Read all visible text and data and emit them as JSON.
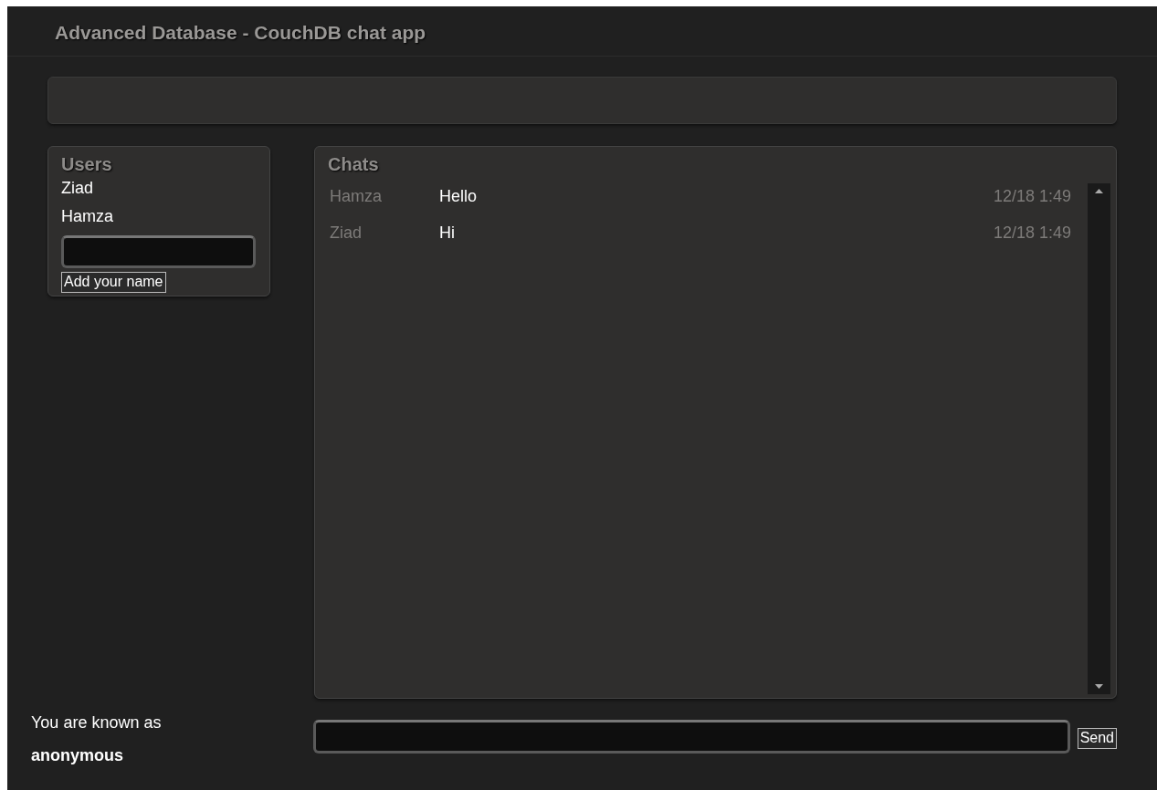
{
  "header": {
    "title": "Advanced Database - CouchDB chat app"
  },
  "users": {
    "title": "Users",
    "names": [
      "Ziad",
      "Hamza"
    ],
    "button": "Add your name"
  },
  "chats": {
    "title": "Chats",
    "messages": [
      {
        "user": "Hamza",
        "text": "Hello",
        "time": "12/18 1:49"
      },
      {
        "user": "Ziad",
        "text": "Hi",
        "time": "12/18 1:49"
      }
    ]
  },
  "identity": {
    "label": "You are known as",
    "name": "anonymous"
  },
  "composer": {
    "button": "Send"
  }
}
